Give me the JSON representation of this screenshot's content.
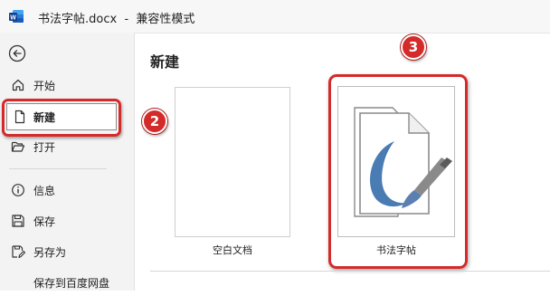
{
  "titlebar": {
    "title": "书法字帖.docx  -  兼容性模式",
    "app_icon": "word-icon"
  },
  "sidebar": {
    "back_icon": "back-arrow-icon",
    "items": [
      {
        "label": "开始",
        "icon": "home-icon"
      },
      {
        "label": "新建",
        "icon": "new-document-icon",
        "selected": true
      },
      {
        "label": "打开",
        "icon": "folder-open-icon"
      },
      {
        "label": "信息",
        "icon": "info-icon"
      },
      {
        "label": "保存",
        "icon": "save-icon"
      },
      {
        "label": "另存为",
        "icon": "save-as-icon"
      },
      {
        "label": "保存到百度网盘",
        "icon": ""
      }
    ]
  },
  "main": {
    "section_title": "新建",
    "templates": [
      {
        "label": "空白文档"
      },
      {
        "label": "书法字帖"
      }
    ]
  },
  "annotations": {
    "badge_new": "2",
    "badge_template": "3",
    "highlight_color": "#d42a2a"
  }
}
